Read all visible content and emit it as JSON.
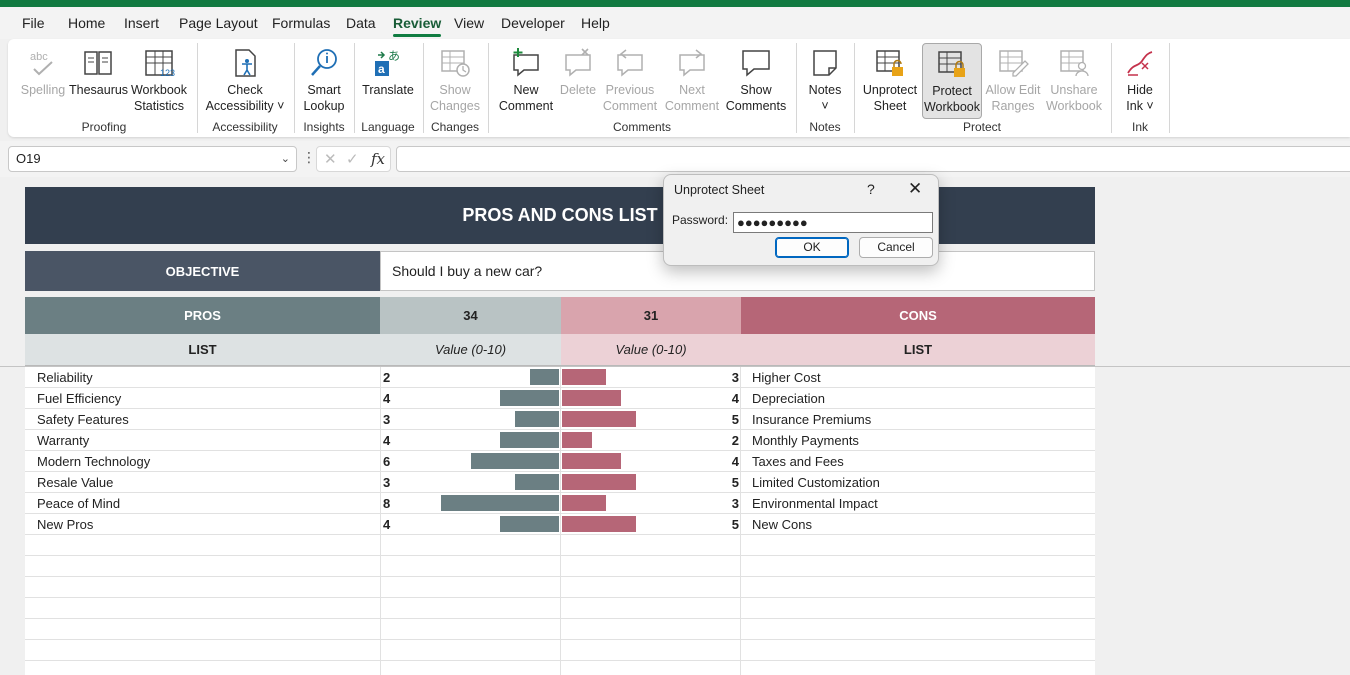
{
  "menu": {
    "tabs": [
      "File",
      "Home",
      "Insert",
      "Page Layout",
      "Formulas",
      "Data",
      "Review",
      "View",
      "Developer",
      "Help"
    ],
    "active": "Review"
  },
  "ribbon": {
    "buttons": {
      "spelling": "Spelling",
      "thesaurus": "Thesaurus",
      "workbook_statistics_1": "Workbook",
      "workbook_statistics_2": "Statistics",
      "check_accessibility_1": "Check",
      "check_accessibility_2": "Accessibility ˅",
      "smart_lookup_1": "Smart",
      "smart_lookup_2": "Lookup",
      "translate": "Translate",
      "show_changes_1": "Show",
      "show_changes_2": "Changes",
      "new_comment_1": "New",
      "new_comment_2": "Comment",
      "delete": "Delete",
      "previous_comment_1": "Previous",
      "previous_comment_2": "Comment",
      "next_comment_1": "Next",
      "next_comment_2": "Comment",
      "show_comments_1": "Show",
      "show_comments_2": "Comments",
      "notes_1": "Notes",
      "notes_2": "˅",
      "unprotect_sheet_1": "Unprotect",
      "unprotect_sheet_2": "Sheet",
      "protect_workbook_1": "Protect",
      "protect_workbook_2": "Workbook",
      "allow_edit_ranges_1": "Allow Edit",
      "allow_edit_ranges_2": "Ranges",
      "unshare_workbook_1": "Unshare",
      "unshare_workbook_2": "Workbook",
      "hide_ink_1": "Hide",
      "hide_ink_2": "Ink ˅"
    },
    "groups": {
      "proofing": "Proofing",
      "accessibility": "Accessibility",
      "insights": "Insights",
      "language": "Language",
      "changes": "Changes",
      "comments": "Comments",
      "notes": "Notes",
      "protect": "Protect",
      "ink": "Ink"
    },
    "icon_names": [
      "abc-icon",
      "thesaurus-icon",
      "workbook-statistics-icon",
      "accessibility-icon",
      "smart-lookup-icon",
      "translate-icon",
      "show-changes-icon",
      "new-comment-icon",
      "delete-comment-icon",
      "previous-comment-icon",
      "next-comment-icon",
      "show-comments-icon",
      "notes-icon",
      "unprotect-sheet-icon",
      "protect-workbook-icon",
      "allow-edit-ranges-icon",
      "unshare-workbook-icon",
      "hide-ink-icon"
    ]
  },
  "formula_bar": {
    "name_box": "O19",
    "fx": "fx",
    "formula": ""
  },
  "sheet": {
    "title": "PROS AND CONS LIST",
    "objective_label": "OBJECTIVE",
    "objective_value": "Should I buy a new car?",
    "pros_header": "PROS",
    "pros_total": "34",
    "cons_total": "31",
    "cons_header": "CONS",
    "list_label_left": "LIST",
    "value_label_left": "Value (0-10)",
    "value_label_right": "Value (0-10)",
    "list_label_right": "LIST",
    "pros": [
      {
        "name": "Reliability",
        "value": 2
      },
      {
        "name": "Fuel Efficiency",
        "value": 4
      },
      {
        "name": "Safety Features",
        "value": 3
      },
      {
        "name": "Warranty",
        "value": 4
      },
      {
        "name": "Modern Technology",
        "value": 6
      },
      {
        "name": "Resale Value",
        "value": 3
      },
      {
        "name": "Peace of Mind",
        "value": 8
      },
      {
        "name": "New Pros",
        "value": 4
      }
    ],
    "cons": [
      {
        "name": "Higher Cost",
        "value": 3
      },
      {
        "name": "Depreciation",
        "value": 4
      },
      {
        "name": "Insurance Premiums",
        "value": 5
      },
      {
        "name": "Monthly Payments",
        "value": 2
      },
      {
        "name": "Taxes and Fees",
        "value": 4
      },
      {
        "name": "Limited Customization",
        "value": 5
      },
      {
        "name": "Environmental Impact",
        "value": 3
      },
      {
        "name": "New Cons",
        "value": 5
      }
    ],
    "colors": {
      "title_bg": "#333f4f",
      "pros_header_bg": "#6b7f83",
      "cons_header_bg": "#b66677",
      "pro_bar": "#6b7f83",
      "con_bar": "#b66677"
    }
  },
  "dialog": {
    "title": "Unprotect Sheet",
    "help": "?",
    "close": "✕",
    "password_label": "Password:",
    "password_value": "●●●●●●●●●",
    "ok": "OK",
    "cancel": "Cancel"
  }
}
